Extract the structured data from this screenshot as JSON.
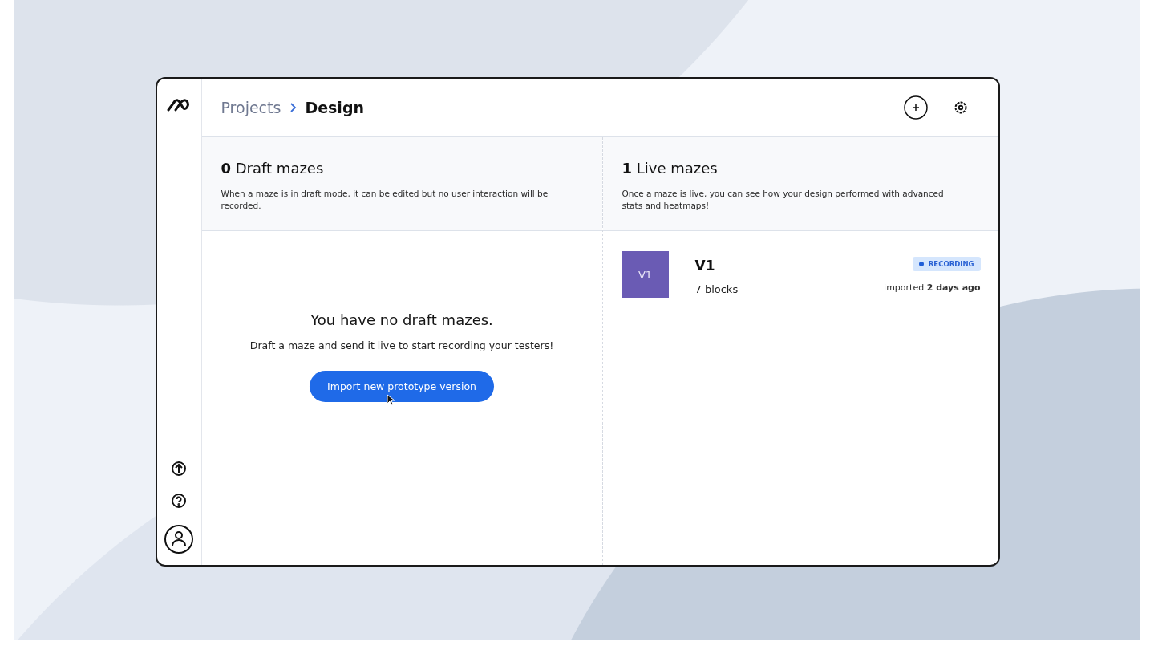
{
  "breadcrumb": {
    "parent": "Projects",
    "current": "Design"
  },
  "draft": {
    "heading": "**0** Draft mazes",
    "description": "When a maze is in draft mode, it can be edited but no user interaction will be recorded.",
    "empty_title": "You have no draft mazes.",
    "empty_text": "Draft a maze and send it live to start recording your testers!",
    "button": "Import new prototype version"
  },
  "live": {
    "heading": "**1** Live mazes",
    "description": "Once a maze is live, you can see how your design performed with advanced stats and heatmaps!",
    "mazes": [
      {
        "thumb": "V1",
        "name": "V1",
        "blocks": "7 blocks",
        "status": "RECORDING",
        "imported": "imported **2 days ago**",
        "color": "#6a5bb4"
      }
    ]
  }
}
